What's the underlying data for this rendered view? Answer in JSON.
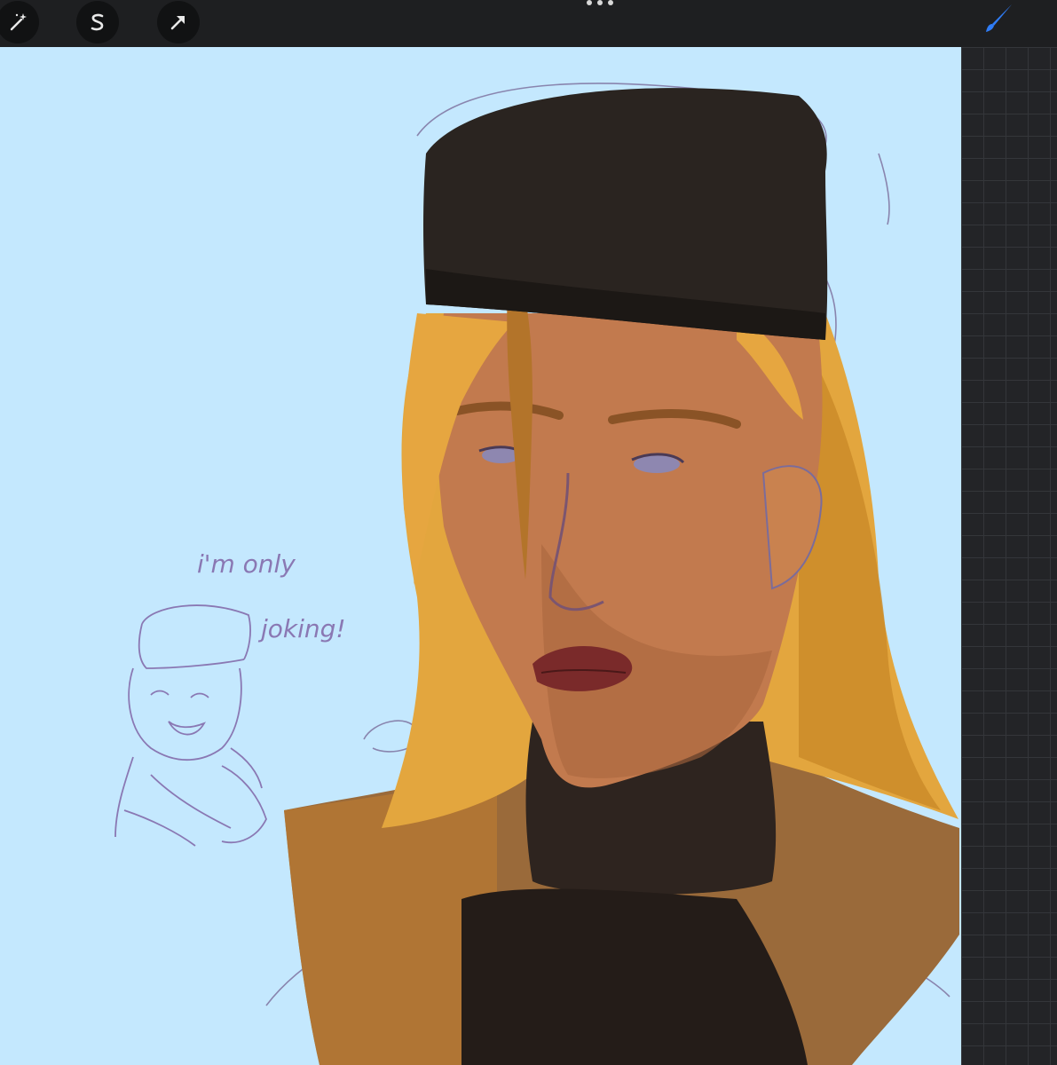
{
  "toolbar": {
    "tools": [
      {
        "name": "adjustments",
        "icon": "magic-wand-icon"
      },
      {
        "name": "selection",
        "icon": "selection-s-icon"
      },
      {
        "name": "transform",
        "icon": "arrow-cursor-icon"
      }
    ],
    "active_tool": "brush",
    "active_tool_icon": "brush-icon",
    "accent_color": "#2f7cf6"
  },
  "canvas": {
    "background_color": "#c4e8fe",
    "sketch_text_line1": "i'm only",
    "sketch_text_line2": "joking!"
  }
}
